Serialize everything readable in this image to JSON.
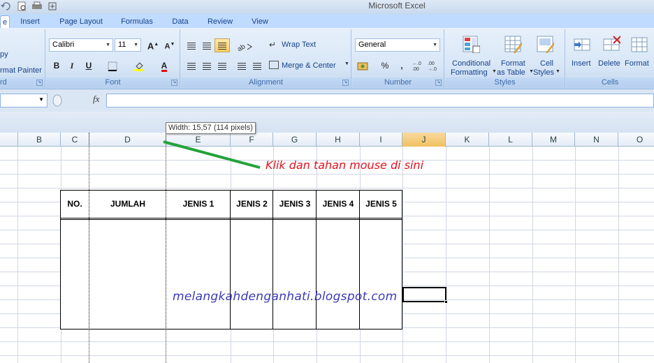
{
  "window": {
    "title": "Microsoft Excel"
  },
  "tabs": [
    "e",
    "Insert",
    "Page Layout",
    "Formulas",
    "Data",
    "Review",
    "View"
  ],
  "ribbon": {
    "clipboard": {
      "copy": "py",
      "format_painter": "rmat Painter",
      "label": "rd"
    },
    "font": {
      "name": "Calibri",
      "size": "11",
      "grow": "A",
      "shrink": "A",
      "bold": "B",
      "italic": "I",
      "underline": "U",
      "font_color": "A",
      "label": "Font"
    },
    "alignment": {
      "wrap_text": "Wrap Text",
      "merge_center": "Merge & Center",
      "label": "Alignment"
    },
    "number": {
      "format": "General",
      "percent": "%",
      "comma": ",",
      "label": "Number"
    },
    "styles": {
      "conditional_1": "Conditional",
      "conditional_2": "Formatting",
      "format_table_1": "Format",
      "format_table_2": "as Table",
      "cell_styles_1": "Cell",
      "cell_styles_2": "Styles",
      "label": "Styles"
    },
    "cells": {
      "insert": "Insert",
      "delete": "Delete",
      "format": "Format",
      "label": "Cells"
    }
  },
  "formula_bar": {
    "fx": "fx",
    "value": ""
  },
  "tooltip": "Width: 15,57 (114 pixels)",
  "columns": [
    "B",
    "C",
    "D",
    "E",
    "F",
    "G",
    "H",
    "I",
    "J",
    "K",
    "L",
    "M",
    "N",
    "O"
  ],
  "selected_column": "J",
  "table_headers": [
    "NO.",
    "JUMLAH",
    "JENIS 1",
    "JENIS 2",
    "JENIS 3",
    "JENIS 4",
    "JENIS 5"
  ],
  "annotation": "Klik dan tahan mouse di sini",
  "watermark": "melangkahdenganhati.blogspot.com",
  "colors": {
    "annotation": "#e0141e",
    "arrow": "#22a33a",
    "watermark": "#3a3ab8",
    "selected_header": "#f1c15f"
  }
}
